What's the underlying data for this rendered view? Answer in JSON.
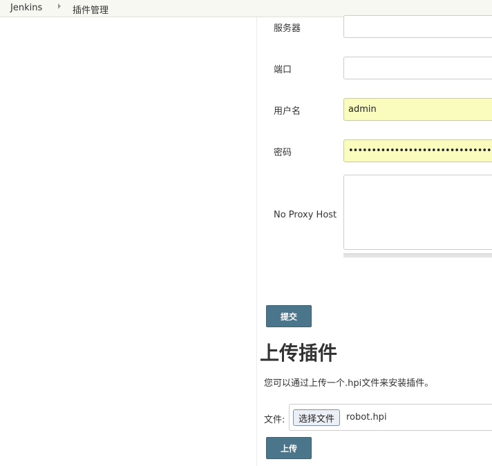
{
  "breadcrumb": {
    "root": "Jenkins",
    "current": "插件管理"
  },
  "proxy_form": {
    "server": {
      "label": "服务器",
      "value": ""
    },
    "port": {
      "label": "端口",
      "value": ""
    },
    "username": {
      "label": "用户名",
      "value": "admin"
    },
    "password": {
      "label": "密码",
      "value": "••••••••••••••••••••••••••••••••"
    },
    "no_proxy_host": {
      "label": "No Proxy Host",
      "value": ""
    },
    "submit_label": "提交"
  },
  "upload": {
    "title": "上传插件",
    "description": "您可以通过上传一个.hpi文件来安装插件。",
    "file_label": "文件:",
    "choose_file_label": "选择文件",
    "file_name": "robot.hpi",
    "upload_label": "上传"
  },
  "colors": {
    "button": "#4b758b",
    "autofill": "#fafcbd"
  }
}
